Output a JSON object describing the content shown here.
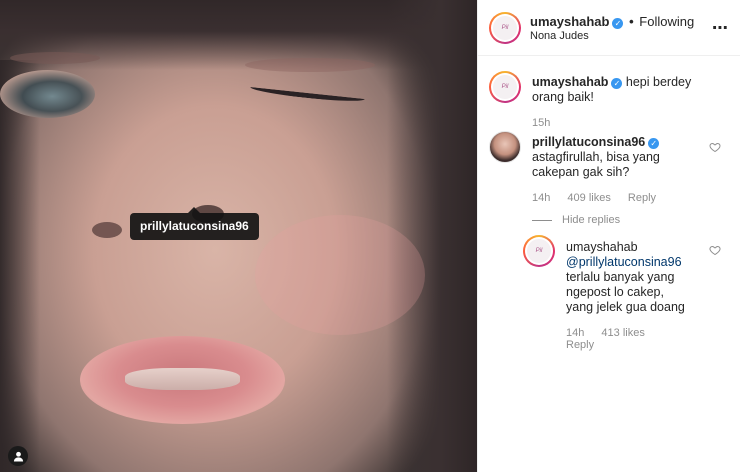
{
  "post": {
    "username": "umayshahab",
    "follow_separator": "•",
    "follow_status": "Following",
    "location": "Nona Judes",
    "more_icon": "⋯"
  },
  "media": {
    "tag_label": "prillylatuconsina96"
  },
  "caption": {
    "username": "umayshahab",
    "text": "hepi berdey orang baik!",
    "time": "15h"
  },
  "comments": [
    {
      "username": "prillylatuconsina96",
      "text": "astagfirullah, bisa yang cakepan gak sih?",
      "time": "14h",
      "likes": "409 likes",
      "reply_label": "Reply",
      "hide_replies": "Hide replies",
      "replies": [
        {
          "username": "umayshahab",
          "mention": "@prillylatuconsina96",
          "text": "terlalu banyak yang ngepost lo cakep, yang jelek gua doang",
          "time": "14h",
          "likes": "413 likes",
          "reply_label": "Reply"
        }
      ]
    }
  ],
  "avatar_placeholder": "Pil",
  "colors": {
    "verified": "#3897f0",
    "secondary_text": "#8e8e8e",
    "mention": "#00376b"
  }
}
